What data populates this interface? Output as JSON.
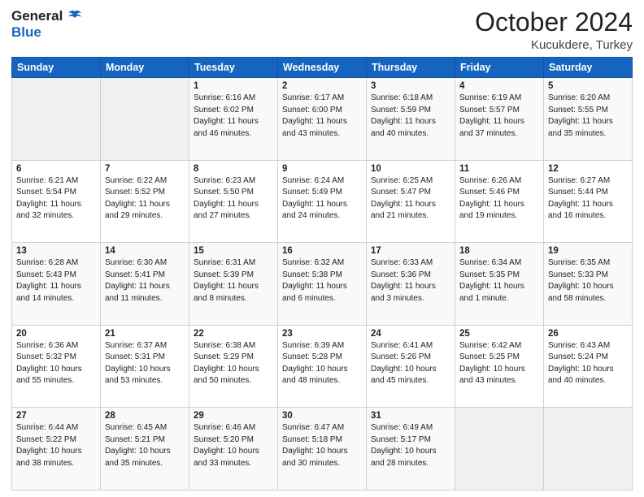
{
  "header": {
    "logo_line1a": "General",
    "logo_line2": "Blue",
    "title": "October 2024",
    "location": "Kucukdere, Turkey"
  },
  "weekdays": [
    "Sunday",
    "Monday",
    "Tuesday",
    "Wednesday",
    "Thursday",
    "Friday",
    "Saturday"
  ],
  "weeks": [
    [
      {
        "day": "",
        "info": ""
      },
      {
        "day": "",
        "info": ""
      },
      {
        "day": "1",
        "info": "Sunrise: 6:16 AM\nSunset: 6:02 PM\nDaylight: 11 hours and 46 minutes."
      },
      {
        "day": "2",
        "info": "Sunrise: 6:17 AM\nSunset: 6:00 PM\nDaylight: 11 hours and 43 minutes."
      },
      {
        "day": "3",
        "info": "Sunrise: 6:18 AM\nSunset: 5:59 PM\nDaylight: 11 hours and 40 minutes."
      },
      {
        "day": "4",
        "info": "Sunrise: 6:19 AM\nSunset: 5:57 PM\nDaylight: 11 hours and 37 minutes."
      },
      {
        "day": "5",
        "info": "Sunrise: 6:20 AM\nSunset: 5:55 PM\nDaylight: 11 hours and 35 minutes."
      }
    ],
    [
      {
        "day": "6",
        "info": "Sunrise: 6:21 AM\nSunset: 5:54 PM\nDaylight: 11 hours and 32 minutes."
      },
      {
        "day": "7",
        "info": "Sunrise: 6:22 AM\nSunset: 5:52 PM\nDaylight: 11 hours and 29 minutes."
      },
      {
        "day": "8",
        "info": "Sunrise: 6:23 AM\nSunset: 5:50 PM\nDaylight: 11 hours and 27 minutes."
      },
      {
        "day": "9",
        "info": "Sunrise: 6:24 AM\nSunset: 5:49 PM\nDaylight: 11 hours and 24 minutes."
      },
      {
        "day": "10",
        "info": "Sunrise: 6:25 AM\nSunset: 5:47 PM\nDaylight: 11 hours and 21 minutes."
      },
      {
        "day": "11",
        "info": "Sunrise: 6:26 AM\nSunset: 5:46 PM\nDaylight: 11 hours and 19 minutes."
      },
      {
        "day": "12",
        "info": "Sunrise: 6:27 AM\nSunset: 5:44 PM\nDaylight: 11 hours and 16 minutes."
      }
    ],
    [
      {
        "day": "13",
        "info": "Sunrise: 6:28 AM\nSunset: 5:43 PM\nDaylight: 11 hours and 14 minutes."
      },
      {
        "day": "14",
        "info": "Sunrise: 6:30 AM\nSunset: 5:41 PM\nDaylight: 11 hours and 11 minutes."
      },
      {
        "day": "15",
        "info": "Sunrise: 6:31 AM\nSunset: 5:39 PM\nDaylight: 11 hours and 8 minutes."
      },
      {
        "day": "16",
        "info": "Sunrise: 6:32 AM\nSunset: 5:38 PM\nDaylight: 11 hours and 6 minutes."
      },
      {
        "day": "17",
        "info": "Sunrise: 6:33 AM\nSunset: 5:36 PM\nDaylight: 11 hours and 3 minutes."
      },
      {
        "day": "18",
        "info": "Sunrise: 6:34 AM\nSunset: 5:35 PM\nDaylight: 11 hours and 1 minute."
      },
      {
        "day": "19",
        "info": "Sunrise: 6:35 AM\nSunset: 5:33 PM\nDaylight: 10 hours and 58 minutes."
      }
    ],
    [
      {
        "day": "20",
        "info": "Sunrise: 6:36 AM\nSunset: 5:32 PM\nDaylight: 10 hours and 55 minutes."
      },
      {
        "day": "21",
        "info": "Sunrise: 6:37 AM\nSunset: 5:31 PM\nDaylight: 10 hours and 53 minutes."
      },
      {
        "day": "22",
        "info": "Sunrise: 6:38 AM\nSunset: 5:29 PM\nDaylight: 10 hours and 50 minutes."
      },
      {
        "day": "23",
        "info": "Sunrise: 6:39 AM\nSunset: 5:28 PM\nDaylight: 10 hours and 48 minutes."
      },
      {
        "day": "24",
        "info": "Sunrise: 6:41 AM\nSunset: 5:26 PM\nDaylight: 10 hours and 45 minutes."
      },
      {
        "day": "25",
        "info": "Sunrise: 6:42 AM\nSunset: 5:25 PM\nDaylight: 10 hours and 43 minutes."
      },
      {
        "day": "26",
        "info": "Sunrise: 6:43 AM\nSunset: 5:24 PM\nDaylight: 10 hours and 40 minutes."
      }
    ],
    [
      {
        "day": "27",
        "info": "Sunrise: 6:44 AM\nSunset: 5:22 PM\nDaylight: 10 hours and 38 minutes."
      },
      {
        "day": "28",
        "info": "Sunrise: 6:45 AM\nSunset: 5:21 PM\nDaylight: 10 hours and 35 minutes."
      },
      {
        "day": "29",
        "info": "Sunrise: 6:46 AM\nSunset: 5:20 PM\nDaylight: 10 hours and 33 minutes."
      },
      {
        "day": "30",
        "info": "Sunrise: 6:47 AM\nSunset: 5:18 PM\nDaylight: 10 hours and 30 minutes."
      },
      {
        "day": "31",
        "info": "Sunrise: 6:49 AM\nSunset: 5:17 PM\nDaylight: 10 hours and 28 minutes."
      },
      {
        "day": "",
        "info": ""
      },
      {
        "day": "",
        "info": ""
      }
    ]
  ]
}
